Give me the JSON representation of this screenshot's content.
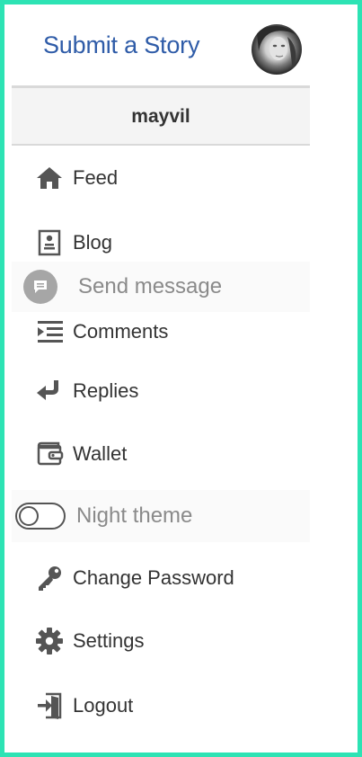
{
  "header": {
    "submit_label": "Submit a Story"
  },
  "user": {
    "username": "mayvil"
  },
  "menu": {
    "feed": "Feed",
    "blog": "Blog",
    "send_message": "Send message",
    "comments": "Comments",
    "replies": "Replies",
    "wallet": "Wallet",
    "night_theme": "Night theme",
    "change_password": "Change Password",
    "settings": "Settings",
    "logout": "Logout"
  },
  "toggle": {
    "night_theme_enabled": false
  },
  "colors": {
    "frame_border": "#2de3b4",
    "link": "#2f5ca8",
    "icon": "#555555",
    "text": "#333333",
    "muted_text": "#8a8a8a"
  },
  "icons": {
    "feed": "home-icon",
    "blog": "blog-icon",
    "send_message": "message-bubble-icon",
    "comments": "comments-icon",
    "replies": "reply-icon",
    "wallet": "wallet-icon",
    "change_password": "key-icon",
    "settings": "gear-icon",
    "logout": "logout-icon"
  }
}
